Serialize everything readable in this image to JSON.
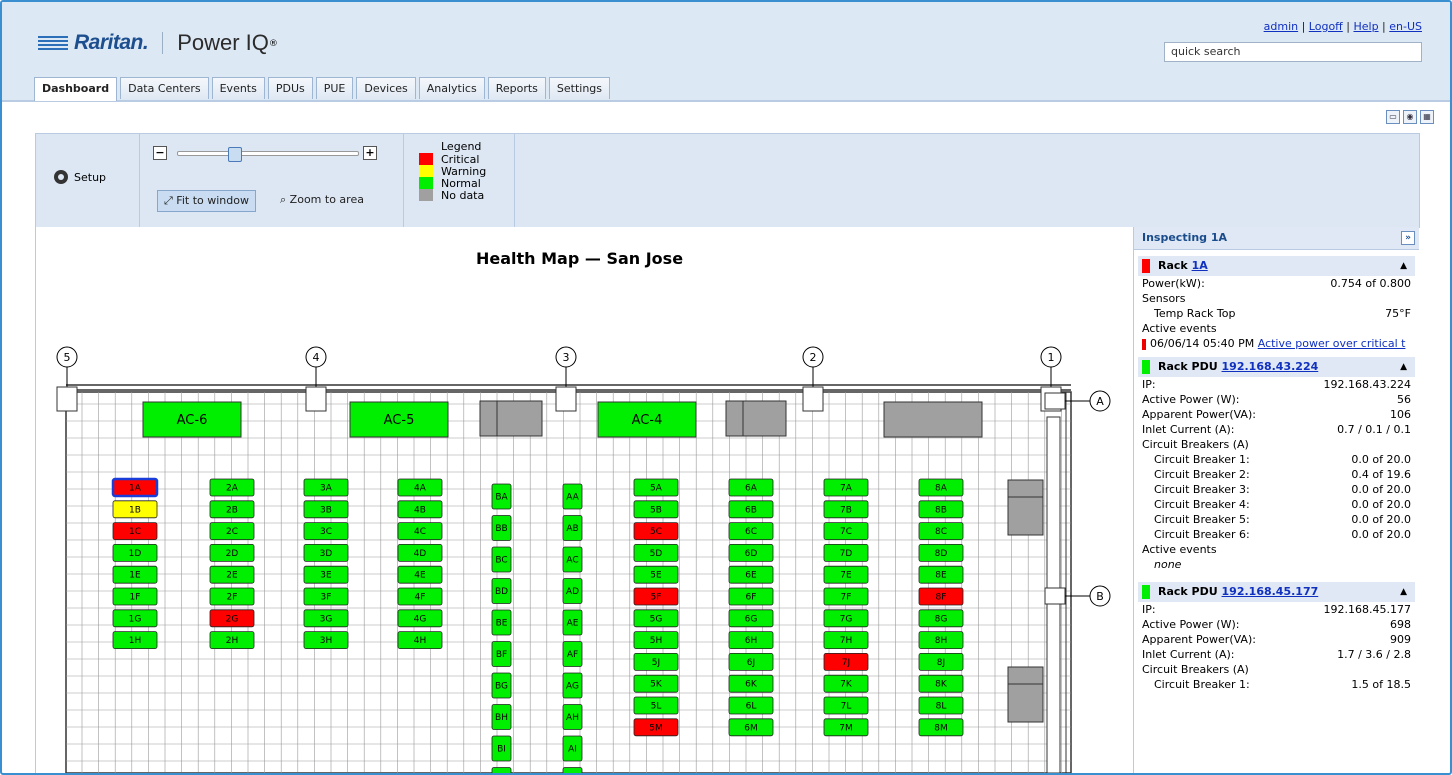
{
  "header": {
    "brand": "Raritan.",
    "product": "Power IQ",
    "product_mark": "®",
    "links": [
      "admin",
      "Logoff",
      "Help",
      "en-US"
    ],
    "search_placeholder": "quick search"
  },
  "tabs": [
    "Dashboard",
    "Data Centers",
    "Events",
    "PDUs",
    "PUE",
    "Devices",
    "Analytics",
    "Reports",
    "Settings"
  ],
  "active_tab": "Dashboard",
  "controls": {
    "setup_label": "Setup",
    "zoom_minus": "−",
    "zoom_plus": "+",
    "zoom_level": 0.3,
    "fit_label": "Fit to window",
    "zoom_area_label": "Zoom to area"
  },
  "legend": {
    "title": "Legend",
    "items": [
      {
        "label": "Critical",
        "color": "#ff0000"
      },
      {
        "label": "Warning",
        "color": "#ffff00"
      },
      {
        "label": "Normal",
        "color": "#00ee00"
      },
      {
        "label": "No data",
        "color": "#a0a0a0"
      }
    ]
  },
  "map": {
    "title": "Health Map — San Jose",
    "columns": [
      "5",
      "4",
      "3",
      "2",
      "1"
    ],
    "row_markers": [
      "A",
      "B"
    ],
    "ac_units": [
      "AC-6",
      "AC-5",
      "AC-4"
    ],
    "rack_rows": [
      {
        "racks": [
          [
            "1A",
            "critical"
          ],
          [
            "1B",
            "warning"
          ],
          [
            "1C",
            "critical"
          ],
          [
            "1D",
            "normal"
          ],
          [
            "1E",
            "normal"
          ],
          [
            "1F",
            "normal"
          ],
          [
            "1G",
            "normal"
          ],
          [
            "1H",
            "normal"
          ]
        ]
      },
      {
        "racks": [
          [
            "2A",
            "normal"
          ],
          [
            "2B",
            "normal"
          ],
          [
            "2C",
            "normal"
          ],
          [
            "2D",
            "normal"
          ],
          [
            "2E",
            "normal"
          ],
          [
            "2F",
            "normal"
          ],
          [
            "2G",
            "critical"
          ],
          [
            "2H",
            "normal"
          ]
        ]
      },
      {
        "racks": [
          [
            "3A",
            "normal"
          ],
          [
            "3B",
            "normal"
          ],
          [
            "3C",
            "normal"
          ],
          [
            "3D",
            "normal"
          ],
          [
            "3E",
            "normal"
          ],
          [
            "3F",
            "normal"
          ],
          [
            "3G",
            "normal"
          ],
          [
            "3H",
            "normal"
          ]
        ]
      },
      {
        "racks": [
          [
            "4A",
            "normal"
          ],
          [
            "4B",
            "normal"
          ],
          [
            "4C",
            "normal"
          ],
          [
            "4D",
            "normal"
          ],
          [
            "4E",
            "normal"
          ],
          [
            "4F",
            "normal"
          ],
          [
            "4G",
            "normal"
          ],
          [
            "4H",
            "normal"
          ]
        ]
      },
      {
        "racks": [
          [
            "BA",
            "normal"
          ],
          [
            "BB",
            "normal"
          ],
          [
            "BC",
            "normal"
          ],
          [
            "BD",
            "normal"
          ],
          [
            "BE",
            "normal"
          ],
          [
            "BF",
            "normal"
          ],
          [
            "BG",
            "normal"
          ],
          [
            "BH",
            "normal"
          ],
          [
            "BI",
            "normal"
          ],
          [
            "BJ",
            "normal"
          ]
        ]
      },
      {
        "racks": [
          [
            "AA",
            "normal"
          ],
          [
            "AB",
            "normal"
          ],
          [
            "AC",
            "normal"
          ],
          [
            "AD",
            "normal"
          ],
          [
            "AE",
            "normal"
          ],
          [
            "AF",
            "normal"
          ],
          [
            "AG",
            "normal"
          ],
          [
            "AH",
            "normal"
          ],
          [
            "AI",
            "normal"
          ],
          [
            "AJ",
            "normal"
          ]
        ]
      },
      {
        "racks": [
          [
            "5A",
            "normal"
          ],
          [
            "5B",
            "normal"
          ],
          [
            "5C",
            "critical"
          ],
          [
            "5D",
            "normal"
          ],
          [
            "5E",
            "normal"
          ],
          [
            "5F",
            "critical"
          ],
          [
            "5G",
            "normal"
          ],
          [
            "5H",
            "normal"
          ],
          [
            "5J",
            "normal"
          ],
          [
            "5K",
            "normal"
          ],
          [
            "5L",
            "normal"
          ],
          [
            "5M",
            "critical"
          ]
        ]
      },
      {
        "racks": [
          [
            "6A",
            "normal"
          ],
          [
            "6B",
            "normal"
          ],
          [
            "6C",
            "normal"
          ],
          [
            "6D",
            "normal"
          ],
          [
            "6E",
            "normal"
          ],
          [
            "6F",
            "normal"
          ],
          [
            "6G",
            "normal"
          ],
          [
            "6H",
            "normal"
          ],
          [
            "6J",
            "normal"
          ],
          [
            "6K",
            "normal"
          ],
          [
            "6L",
            "normal"
          ],
          [
            "6M",
            "normal"
          ]
        ]
      },
      {
        "racks": [
          [
            "7A",
            "normal"
          ],
          [
            "7B",
            "normal"
          ],
          [
            "7C",
            "normal"
          ],
          [
            "7D",
            "normal"
          ],
          [
            "7E",
            "normal"
          ],
          [
            "7F",
            "normal"
          ],
          [
            "7G",
            "normal"
          ],
          [
            "7H",
            "normal"
          ],
          [
            "7J",
            "critical"
          ],
          [
            "7K",
            "normal"
          ],
          [
            "7L",
            "normal"
          ],
          [
            "7M",
            "normal"
          ]
        ]
      },
      {
        "racks": [
          [
            "8A",
            "normal"
          ],
          [
            "8B",
            "normal"
          ],
          [
            "8C",
            "normal"
          ],
          [
            "8D",
            "normal"
          ],
          [
            "8E",
            "normal"
          ],
          [
            "8F",
            "critical"
          ],
          [
            "8G",
            "normal"
          ],
          [
            "8H",
            "normal"
          ],
          [
            "8J",
            "normal"
          ],
          [
            "8K",
            "normal"
          ],
          [
            "8L",
            "normal"
          ],
          [
            "8M",
            "normal"
          ]
        ]
      }
    ],
    "selected_rack": "1A",
    "status_colors": {
      "critical": "#ff0000",
      "warning": "#ffff00",
      "normal": "#00ee00",
      "nodata": "#a0a0a0"
    }
  },
  "inspect": {
    "title": "Inspecting 1A",
    "rack": {
      "heading": "Rack",
      "link": "1A",
      "status_color": "#ff0000",
      "power_label": "Power(kW):",
      "power_value": "0.754 of 0.800",
      "sensors_label": "Sensors",
      "sensor_name": "Temp Rack Top",
      "sensor_value": "75°F",
      "events_label": "Active events",
      "event_time": "06/06/14 05:40 PM",
      "event_text": "Active power over critical t"
    },
    "pdu1": {
      "heading": "Rack PDU",
      "link": "192.168.43.224",
      "status_color": "#00ee00",
      "rows": [
        {
          "k": "IP:",
          "v": "192.168.43.224"
        },
        {
          "k": "Active Power (W):",
          "v": "56"
        },
        {
          "k": "Apparent Power(VA):",
          "v": "106"
        },
        {
          "k": "Inlet Current (A):",
          "v": "0.7 / 0.1 / 0.1"
        }
      ],
      "cb_label": "Circuit Breakers (A)",
      "breakers": [
        {
          "k": "Circuit Breaker 1:",
          "v": "0.0 of 20.0"
        },
        {
          "k": "Circuit Breaker 2:",
          "v": "0.4 of 19.6"
        },
        {
          "k": "Circuit Breaker 3:",
          "v": "0.0 of 20.0"
        },
        {
          "k": "Circuit Breaker 4:",
          "v": "0.0 of 20.0"
        },
        {
          "k": "Circuit Breaker 5:",
          "v": "0.0 of 20.0"
        },
        {
          "k": "Circuit Breaker 6:",
          "v": "0.0 of 20.0"
        }
      ],
      "events_label": "Active events",
      "events_none": "none"
    },
    "pdu2": {
      "heading": "Rack PDU",
      "link": "192.168.45.177",
      "status_color": "#00ee00",
      "rows": [
        {
          "k": "IP:",
          "v": "192.168.45.177"
        },
        {
          "k": "Active Power (W):",
          "v": "698"
        },
        {
          "k": "Apparent Power(VA):",
          "v": "909"
        },
        {
          "k": "Inlet Current (A):",
          "v": "1.7 / 3.6 / 2.8"
        }
      ],
      "cb_label": "Circuit Breakers (A)",
      "breakers": [
        {
          "k": "Circuit Breaker 1:",
          "v": "1.5 of 18.5"
        }
      ]
    }
  }
}
